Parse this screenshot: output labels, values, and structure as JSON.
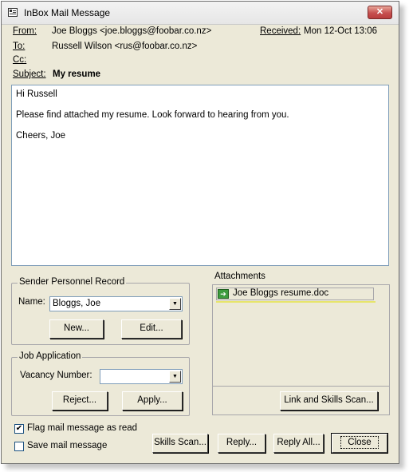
{
  "window": {
    "title": "InBox Mail Message",
    "close_symbol": "✕"
  },
  "header": {
    "from_label": "From:",
    "from_value": "Joe Bloggs <joe.bloggs@foobar.co.nz>",
    "received_label": "Received:",
    "received_value": "Mon 12-Oct 13:06",
    "to_label": "To:",
    "to_value": "Russell Wilson <rus@foobar.co.nz>",
    "cc_label": "Cc:",
    "cc_value": "",
    "subject_label": "Subject:",
    "subject_value": "My resume"
  },
  "message_body": {
    "lines": [
      "Hi Russell",
      "Please find attached my resume. Look forward to hearing from you.",
      "Cheers, Joe"
    ]
  },
  "sender_record": {
    "title": "Sender Personnel Record",
    "name_label": "Name:",
    "name_value": "Bloggs, Joe",
    "new_button": "New...",
    "edit_button": "Edit..."
  },
  "job_application": {
    "title": "Job Application",
    "vacancy_label": "Vacancy Number:",
    "vacancy_value": "",
    "reject_button": "Reject...",
    "apply_button": "Apply..."
  },
  "attachments": {
    "title": "Attachments",
    "items": [
      "Joe Bloggs resume.doc"
    ],
    "link_button": "Link and Skills Scan..."
  },
  "options": {
    "flag_read_label": "Flag mail message as read",
    "flag_read_checked": true,
    "save_label": "Save mail message",
    "save_checked": false
  },
  "footer": {
    "skills_scan": "Skills Scan...",
    "reply": "Reply...",
    "reply_all": "Reply All...",
    "close": "Close"
  }
}
